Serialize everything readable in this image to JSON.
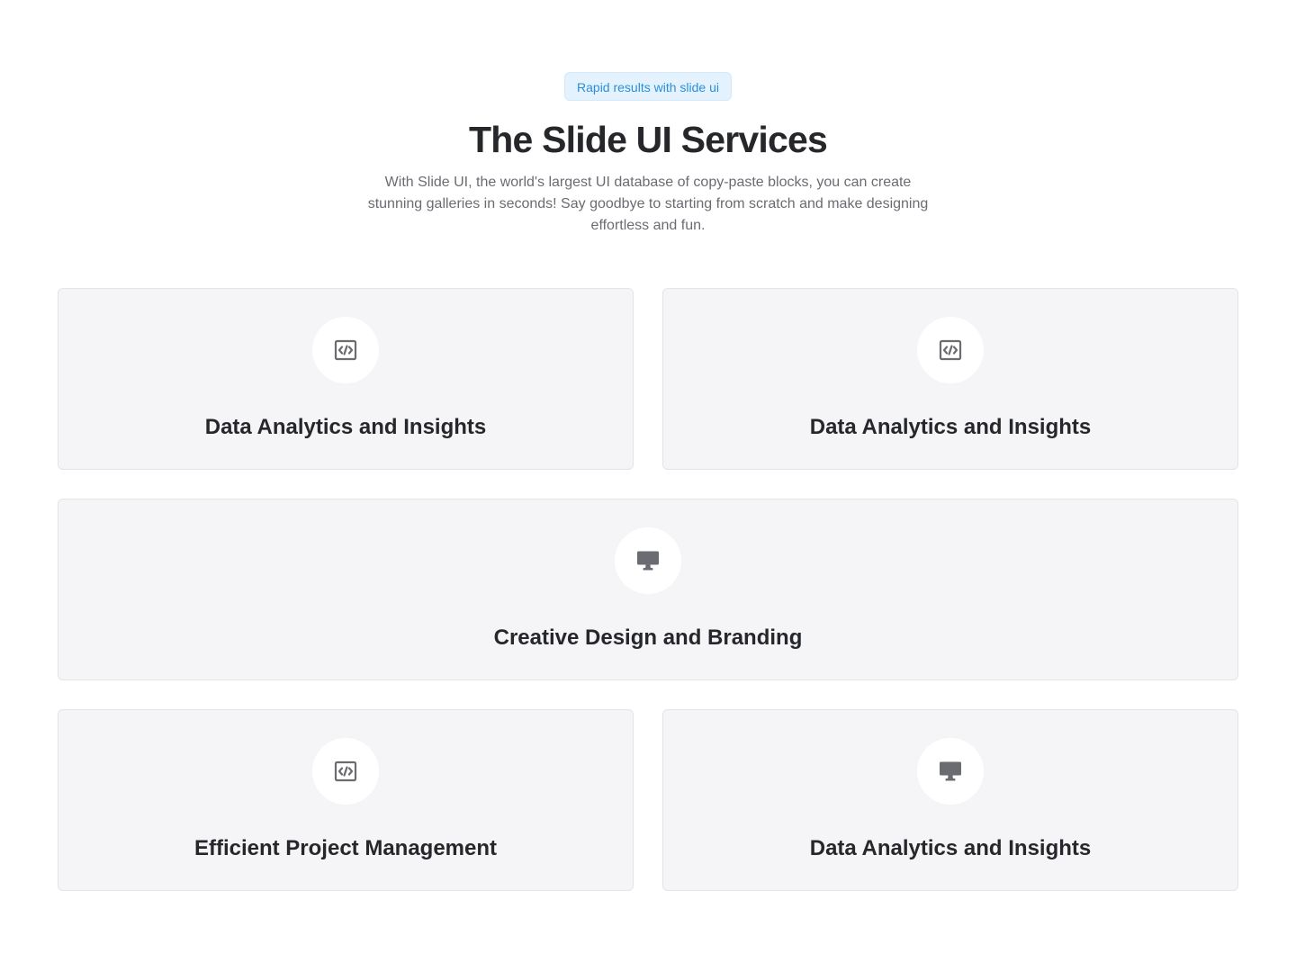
{
  "header": {
    "badge": "Rapid results with slide ui",
    "title": "The Slide UI Services",
    "subtitle": "With Slide UI, the world's largest UI database of copy-paste blocks, you can create stunning galleries in seconds! Say goodbye to starting from scratch and make designing effortless and fun."
  },
  "cards": [
    {
      "icon": "code-icon",
      "title": "Data Analytics and Insights"
    },
    {
      "icon": "code-icon",
      "title": "Data Analytics and Insights"
    },
    {
      "icon": "desktop-monitor-icon",
      "title": "Creative Design and Branding"
    },
    {
      "icon": "code-icon",
      "title": "Efficient Project Management"
    },
    {
      "icon": "desktop-monitor-icon",
      "title": "Data Analytics and Insights"
    }
  ],
  "colors": {
    "badge_text": "#2b8fd8",
    "badge_bg": "#e4f2fe",
    "heading": "#26272b",
    "body_text": "#6b6c72",
    "card_bg": "#f5f5f7",
    "icon": "#6b6c72"
  }
}
